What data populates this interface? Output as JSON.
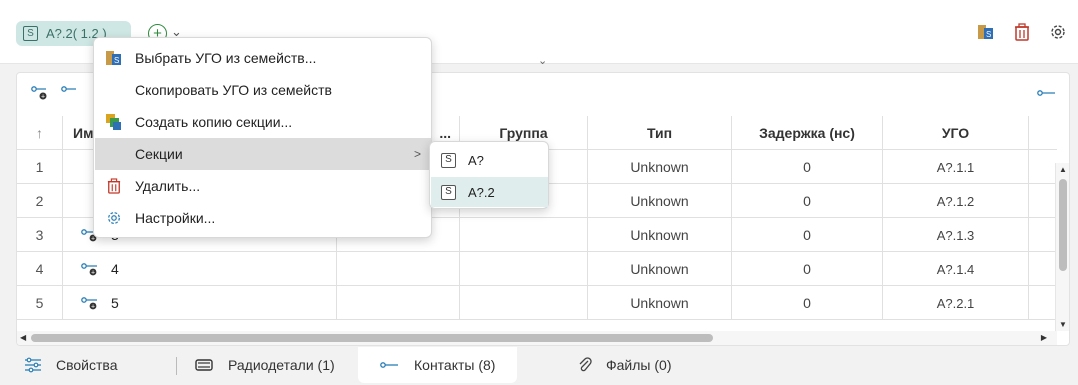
{
  "header": {
    "section_chip": "A?.2( 1.2 )",
    "section_chip_badge": "S",
    "add_chevron": "⌄"
  },
  "panel": {
    "collapse_glyph": "⌄"
  },
  "table": {
    "headers": {
      "sort": "↑",
      "name": "Им",
      "p": "...",
      "group": "Группа",
      "type": "Тип",
      "delay": "Задержка (нс)",
      "ugo": "УГО"
    },
    "rows": [
      {
        "num": "1",
        "name": "",
        "type": "Unknown",
        "delay": "0",
        "ugo": "A?.1.1"
      },
      {
        "num": "2",
        "name": "",
        "type": "Unknown",
        "delay": "0",
        "ugo": "A?.1.2"
      },
      {
        "num": "3",
        "name": "3",
        "type": "Unknown",
        "delay": "0",
        "ugo": "A?.1.3"
      },
      {
        "num": "4",
        "name": "4",
        "type": "Unknown",
        "delay": "0",
        "ugo": "A?.1.4"
      },
      {
        "num": "5",
        "name": "5",
        "type": "Unknown",
        "delay": "0",
        "ugo": "A?.2.1"
      }
    ]
  },
  "context_menu": {
    "items": [
      {
        "label": "Выбрать УГО из семейств..."
      },
      {
        "label": "Скопировать УГО из семейств"
      },
      {
        "label": "Создать копию секции..."
      },
      {
        "label": "Секции",
        "arrow": ">"
      },
      {
        "label": "Удалить..."
      },
      {
        "label": "Настройки..."
      }
    ]
  },
  "submenu": {
    "items": [
      {
        "badge": "S",
        "label": "A?"
      },
      {
        "badge": "S",
        "label": "A?.2"
      }
    ]
  },
  "tabs": [
    {
      "label": "Свойства"
    },
    {
      "label": "Радиодетали (1)"
    },
    {
      "label": "Контакты (8)"
    },
    {
      "label": "Файлы (0)"
    }
  ],
  "colors": {
    "accent_teal": "#cfe7e4",
    "delete_red": "#c0392b",
    "add_green": "#2e8b3d"
  }
}
